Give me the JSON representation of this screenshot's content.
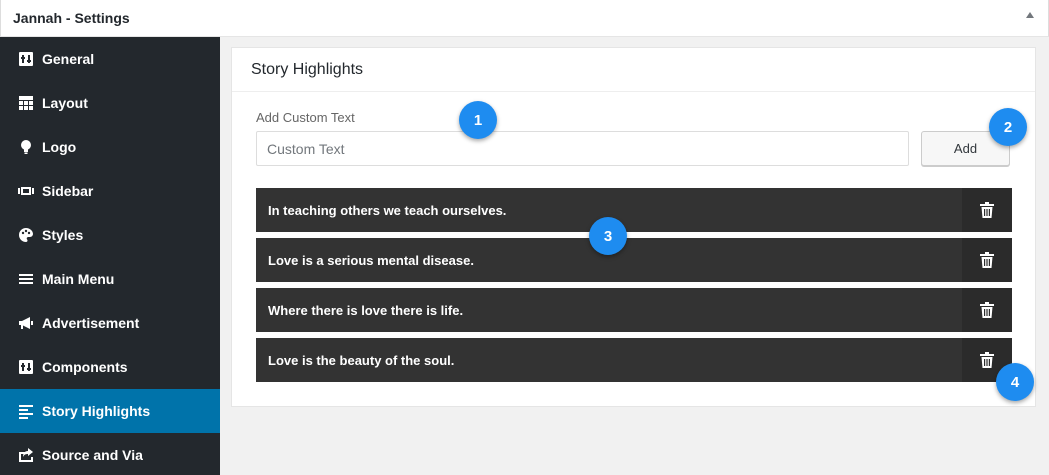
{
  "window": {
    "title": "Jannah - Settings",
    "toggle_icon": "triangle-up-icon"
  },
  "sidebar": {
    "items": [
      {
        "label": "General",
        "icon": "general-icon"
      },
      {
        "label": "Layout",
        "icon": "layout-icon"
      },
      {
        "label": "Logo",
        "icon": "lightbulb-icon"
      },
      {
        "label": "Sidebar",
        "icon": "sidebar-icon"
      },
      {
        "label": "Styles",
        "icon": "palette-icon"
      },
      {
        "label": "Main Menu",
        "icon": "menu-icon"
      },
      {
        "label": "Advertisement",
        "icon": "megaphone-icon"
      },
      {
        "label": "Components",
        "icon": "components-icon"
      },
      {
        "label": "Story Highlights",
        "icon": "align-left-icon",
        "active": true
      },
      {
        "label": "Source and Via",
        "icon": "share-icon"
      }
    ]
  },
  "panel": {
    "title": "Story Highlights",
    "field_label": "Add Custom Text",
    "input_placeholder": "Custom Text",
    "add_label": "Add",
    "highlights": [
      "In teaching others we teach ourselves.",
      "Love is a serious mental disease.",
      "Where there is love there is life.",
      "Love is the beauty of the soul."
    ],
    "delete_icon": "trash-icon"
  },
  "annotations": [
    "1",
    "2",
    "3",
    "4"
  ],
  "colors": {
    "sidebar_bg": "#23282d",
    "active_bg": "#0073aa",
    "badge": "#1e8cf0",
    "highlight_bg": "#333333"
  }
}
